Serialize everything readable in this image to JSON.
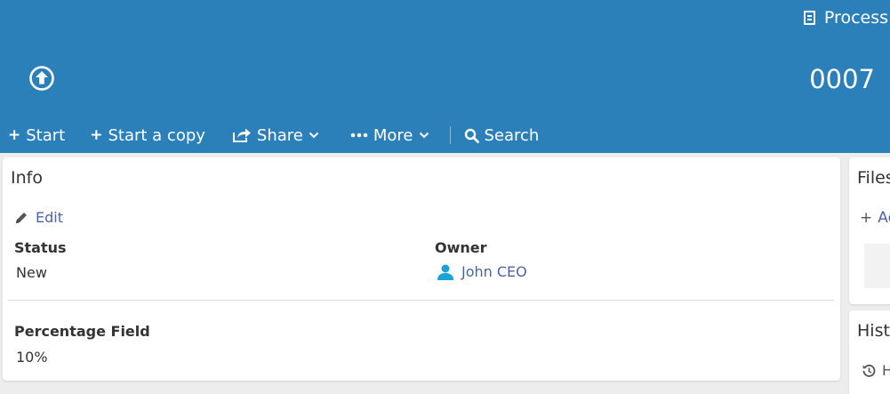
{
  "header": {
    "process_label": "Process",
    "number": "0007"
  },
  "toolbar": {
    "start": "Start",
    "start_copy": "Start a copy",
    "share": "Share",
    "more": "More",
    "search": "Search"
  },
  "info": {
    "title": "Info",
    "edit": "Edit",
    "status_label": "Status",
    "status_value": "New",
    "owner_label": "Owner",
    "owner_value": "John CEO",
    "percentage_label": "Percentage Field",
    "percentage_value": "10%"
  },
  "files": {
    "title": "Files",
    "add": "Ad"
  },
  "history": {
    "title": "Hist",
    "row": "H"
  },
  "colors": {
    "header_bg": "#2b80b9",
    "link": "#4b63a8",
    "owner_icon": "#1aa3d9"
  }
}
